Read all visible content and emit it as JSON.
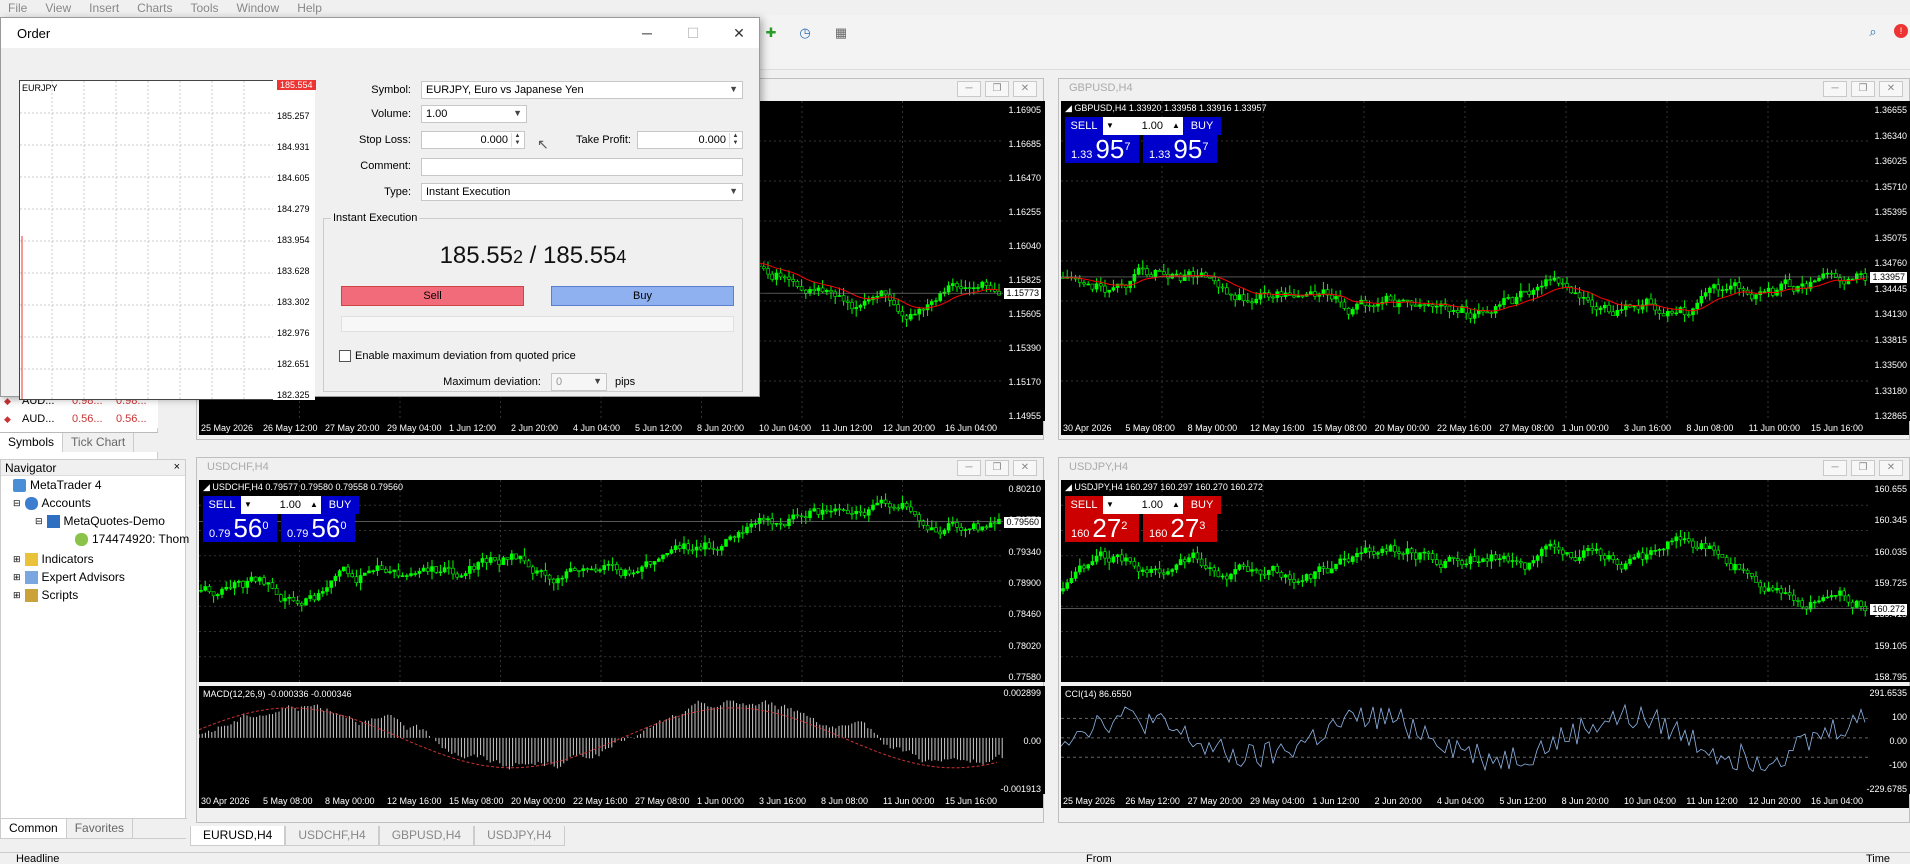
{
  "menu": [
    "File",
    "View",
    "Insert",
    "Charts",
    "Tools",
    "Window",
    "Help"
  ],
  "colors": {
    "bull": "#00ff00",
    "bear": "#00ff00",
    "ma": "#ff0000",
    "sellBlue": "#0000cc",
    "buyBlue": "#0000aa",
    "sellRed": "#cc0000"
  },
  "market_watch": {
    "rows": [
      {
        "sym": "AUD...",
        "bid": "0.98...",
        "ask": "0.98..."
      },
      {
        "sym": "AUD...",
        "bid": "0.56...",
        "ask": "0.56..."
      }
    ],
    "tabs": [
      "Symbols",
      "Tick Chart"
    ]
  },
  "navigator": {
    "title": "Navigator",
    "close": "×",
    "items": [
      "MetaTrader 4",
      "Accounts",
      "MetaQuotes-Demo",
      "174474920: Thom",
      "Indicators",
      "Expert Advisors",
      "Scripts"
    ],
    "tabs": [
      "Common",
      "Favorites"
    ]
  },
  "bottom_tabs": [
    "EURUSD,H4",
    "USDCHF,H4",
    "GBPUSD,H4",
    "USDJPY,H4"
  ],
  "status": {
    "headline": "Headline",
    "from": "From",
    "time": "Time"
  },
  "charts": [
    {
      "id": "eurusd",
      "title": "",
      "yticks": [
        "1.16905",
        "1.16685",
        "1.16470",
        "1.16255",
        "1.16040",
        "1.15825",
        "1.15605",
        "1.15390",
        "1.15170",
        "1.14955"
      ],
      "price": "1.15773",
      "xticks": [
        "25 May 2026",
        "26 May 12:00",
        "27 May 20:00",
        "29 May 04:00",
        "1 Jun 12:00",
        "2 Jun 20:00",
        "4 Jun 04:00",
        "5 Jun 12:00",
        "8 Jun 20:00",
        "10 Jun 04:00",
        "11 Jun 12:00",
        "12 Jun 20:00",
        "16 Jun 04:00"
      ]
    },
    {
      "id": "gbpusd",
      "title": "GBPUSD,H4",
      "label": "GBPUSD,H4  1.33920 1.33958 1.33916 1.33957",
      "yticks": [
        "1.36655",
        "1.36340",
        "1.36025",
        "1.35710",
        "1.35395",
        "1.35075",
        "1.34760",
        "1.34445",
        "1.34130",
        "1.33815",
        "1.33500",
        "1.33180",
        "1.32865"
      ],
      "price": "1.33957",
      "xticks": [
        "30 Apr 2026",
        "5 May 08:00",
        "8 May 00:00",
        "12 May 16:00",
        "15 May 08:00",
        "20 May 00:00",
        "22 May 16:00",
        "27 May 08:00",
        "1 Jun 00:00",
        "3 Jun 16:00",
        "8 Jun 08:00",
        "11 Jun 00:00",
        "15 Jun 16:00"
      ],
      "sell": {
        "big": "95",
        "pre": "1.33",
        "sup": "7"
      },
      "buy": {
        "big": "95",
        "pre": "1.33",
        "sup": "7"
      },
      "vol": "1.00"
    },
    {
      "id": "usdchf",
      "title": "USDCHF,H4",
      "label": "USDCHF,H4  0.79577 0.79580 0.79558 0.79560",
      "yticks": [
        "0.80210",
        "0.79770",
        "0.79340",
        "0.78900",
        "0.78460",
        "0.78020",
        "0.77580"
      ],
      "price": "0.79560",
      "ind": "MACD(12,26,9) -0.000336 -0.000346",
      "indticks": [
        "0.002899",
        "0.00",
        "-0.001913"
      ],
      "xticks": [
        "30 Apr 2026",
        "5 May 08:00",
        "8 May 00:00",
        "12 May 16:00",
        "15 May 08:00",
        "20 May 00:00",
        "22 May 16:00",
        "27 May 08:00",
        "1 Jun 00:00",
        "3 Jun 16:00",
        "8 Jun 08:00",
        "11 Jun 00:00",
        "15 Jun 16:00"
      ],
      "sell": {
        "big": "56",
        "pre": "0.79",
        "sup": "0"
      },
      "buy": {
        "big": "56",
        "pre": "0.79",
        "sup": "0"
      },
      "vol": "1.00"
    },
    {
      "id": "usdjpy",
      "title": "USDJPY,H4",
      "label": "USDJPY,H4  160.297 160.297 160.270 160.272",
      "yticks": [
        "160.655",
        "160.345",
        "160.035",
        "159.725",
        "159.415",
        "159.105",
        "158.795"
      ],
      "price": "160.272",
      "ind": "CCI(14) 86.6550",
      "indticks": [
        "291.6535",
        "100",
        "0.00",
        "-100",
        "-229.6785"
      ],
      "xticks": [
        "25 May 2026",
        "26 May 12:00",
        "27 May 20:00",
        "29 May 04:00",
        "1 Jun 12:00",
        "2 Jun 20:00",
        "4 Jun 04:00",
        "5 Jun 12:00",
        "8 Jun 20:00",
        "10 Jun 04:00",
        "11 Jun 12:00",
        "12 Jun 20:00",
        "16 Jun 04:00"
      ],
      "sell": {
        "big": "27",
        "pre": "160",
        "sup": "2"
      },
      "buy": {
        "big": "27",
        "pre": "160",
        "sup": "3"
      },
      "vol": "1.00"
    }
  ],
  "order": {
    "title": "Order",
    "mini_symbol": "EURJPY",
    "mini_ticks": [
      "185.554",
      "185.257",
      "184.931",
      "184.605",
      "184.279",
      "183.954",
      "183.628",
      "183.302",
      "182.976",
      "182.651",
      "182.325"
    ],
    "symbol_label": "Symbol:",
    "symbol": "EURJPY, Euro vs Japanese Yen",
    "volume_label": "Volume:",
    "volume": "1.00",
    "sl_label": "Stop Loss:",
    "sl": "0.000",
    "tp_label": "Take Profit:",
    "tp": "0.000",
    "comment_label": "Comment:",
    "comment": "",
    "type_label": "Type:",
    "type": "Instant Execution",
    "group": "Instant Execution",
    "bid_main": "185.55",
    "bid_small": "2",
    "sep": " / ",
    "ask_main": "185.55",
    "ask_small": "4",
    "sell": "Sell",
    "buy": "Buy",
    "dev_check": "Enable maximum deviation from quoted price",
    "dev_label": "Maximum deviation:",
    "dev": "0",
    "dev_unit": "pips"
  }
}
